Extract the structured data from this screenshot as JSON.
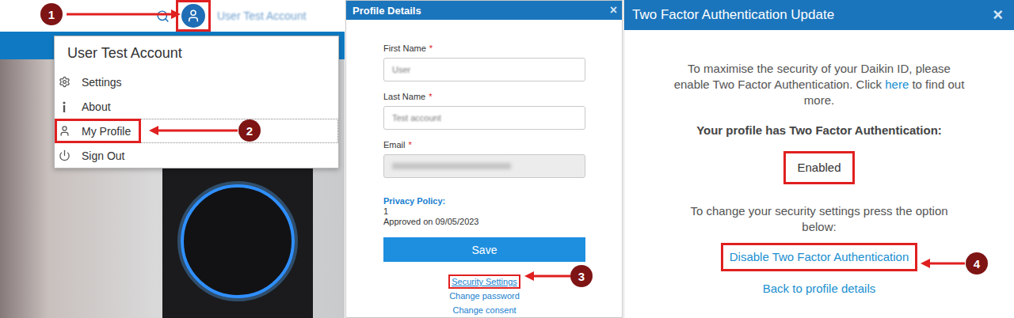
{
  "markers": [
    {
      "label": "1"
    },
    {
      "label": "2"
    },
    {
      "label": "3"
    },
    {
      "label": "4"
    }
  ],
  "top_bar": {
    "account_name": "User Test Account",
    "avatar_highlighted": true
  },
  "menu": {
    "title": "User Test Account",
    "items": [
      {
        "label": "Settings",
        "selected": false
      },
      {
        "label": "About",
        "selected": false
      },
      {
        "label": "My Profile",
        "selected": true
      },
      {
        "label": "Sign Out",
        "selected": false
      }
    ]
  },
  "profile_dialog": {
    "title": "Profile Details",
    "close": "×",
    "fields": [
      {
        "label": "First Name",
        "required_mark": "*",
        "value": "User",
        "blurred": true,
        "disabled": false
      },
      {
        "label": "Last Name",
        "required_mark": "*",
        "value": "Test account",
        "blurred": true,
        "disabled": false
      },
      {
        "label": "Email",
        "required_mark": "*",
        "value": "",
        "blurred": true,
        "disabled": true
      }
    ],
    "privacy": {
      "label": "Privacy Policy:",
      "version": "1",
      "approved": "Approved on 09/05/2023"
    },
    "save_button": "Save",
    "links": [
      {
        "label": "Security Settings",
        "highlighted": true
      },
      {
        "label": "Change password",
        "highlighted": false
      },
      {
        "label": "Change consent",
        "highlighted": false
      }
    ]
  },
  "two_factor_dialog": {
    "title": "Two Factor Authentication Update",
    "close": "×",
    "intro_before": "To maximise the security of your Daikin ID, please enable Two Factor Authentication. Click ",
    "intro_link": "here",
    "intro_after": " to find out more.",
    "status_label": "Your profile has Two Factor Authentication:",
    "status": "Enabled",
    "status_highlighted": true,
    "hint": "To change your security settings press the option below:",
    "actions": [
      {
        "label": "Disable Two Factor Authentication",
        "highlighted": true
      },
      {
        "label": "Back to profile details",
        "highlighted": false
      }
    ]
  }
}
